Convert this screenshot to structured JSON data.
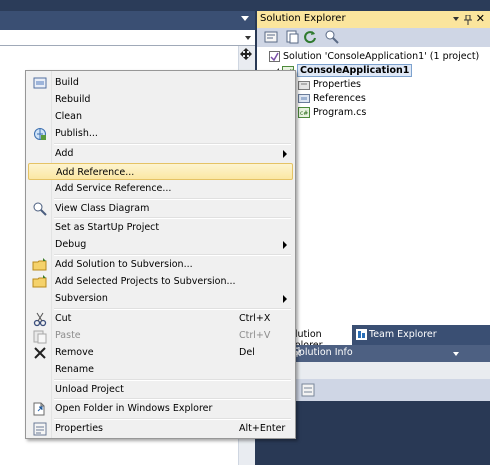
{
  "solution_explorer": {
    "title": "Solution Explorer",
    "solution_node": "Solution 'ConsoleApplication1' (1 project)",
    "project_node": "ConsoleApplication1",
    "children": [
      "Properties",
      "References",
      "Program.cs"
    ]
  },
  "bottom_tabs": {
    "solution_explorer": "Solution Explorer",
    "team_explorer": "Team Explorer"
  },
  "properties_panel": {
    "title": "Solution Info"
  },
  "context_menu": {
    "items": [
      {
        "label": "Build",
        "icon": "build-icon"
      },
      {
        "label": "Rebuild"
      },
      {
        "label": "Clean"
      },
      {
        "label": "Publish...",
        "icon": "publish-icon"
      },
      {
        "label": "Add",
        "submenu": true
      },
      {
        "label": "Add Reference...",
        "highlighted": true
      },
      {
        "label": "Add Service Reference..."
      },
      {
        "label": "View Class Diagram",
        "icon": "class-diagram-icon"
      },
      {
        "label": "Set as StartUp Project"
      },
      {
        "label": "Debug",
        "submenu": true
      },
      {
        "label": "Add Solution to Subversion...",
        "icon": "folder-icon"
      },
      {
        "label": "Add Selected Projects to Subversion...",
        "icon": "folder-icon"
      },
      {
        "label": "Subversion",
        "submenu": true
      },
      {
        "label": "Cut",
        "shortcut": "Ctrl+X",
        "icon": "cut-icon"
      },
      {
        "label": "Paste",
        "shortcut": "Ctrl+V",
        "icon": "paste-icon",
        "disabled": true
      },
      {
        "label": "Remove",
        "shortcut": "Del",
        "icon": "remove-icon"
      },
      {
        "label": "Rename"
      },
      {
        "label": "Unload Project"
      },
      {
        "label": "Open Folder in Windows Explorer",
        "icon": "open-folder-icon"
      },
      {
        "label": "Properties",
        "shortcut": "Alt+Enter",
        "icon": "properties-icon"
      }
    ]
  },
  "colors": {
    "ide_background": "#293955",
    "active_title": "#fbe59d",
    "menu_background": "#f0f0f0",
    "menu_highlight": "#fbe7a3"
  }
}
